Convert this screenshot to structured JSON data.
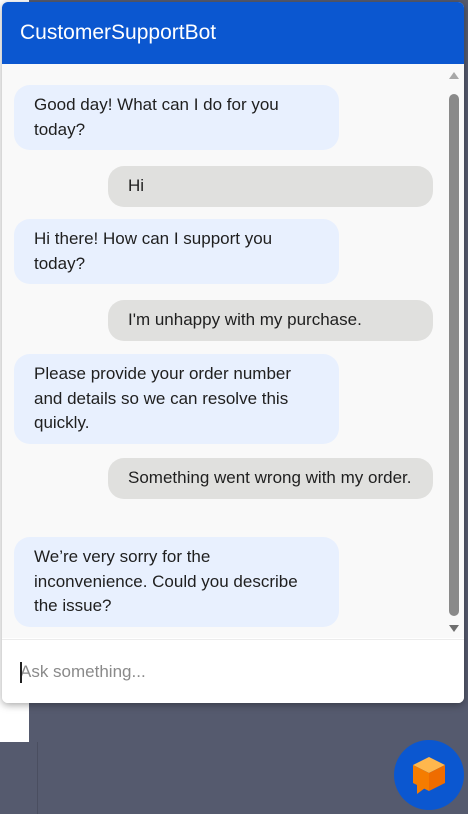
{
  "header": {
    "title": "CustomerSupportBot"
  },
  "messages": [
    {
      "sender": "bot",
      "text": "Good day! What can I do for you today?"
    },
    {
      "sender": "user",
      "text": "Hi"
    },
    {
      "sender": "bot",
      "text": "Hi there! How can I support you today?"
    },
    {
      "sender": "user",
      "text": "I'm unhappy with my purchase."
    },
    {
      "sender": "bot",
      "text": "Please provide your order number and details so we can resolve this quickly."
    },
    {
      "sender": "user",
      "text": "Something went wrong with my order."
    },
    {
      "sender": "bot",
      "text": "We’re very sorry for the inconvenience. Could you describe the issue?"
    }
  ],
  "input": {
    "value": "",
    "placeholder": "Ask something..."
  },
  "launcher": {
    "icon": "cube-chat-icon"
  },
  "colors": {
    "header": "#0b57d0",
    "bot_bubble": "#e8f0fe",
    "user_bubble": "#e0e0de",
    "launcher_icon": "#f57c00"
  }
}
